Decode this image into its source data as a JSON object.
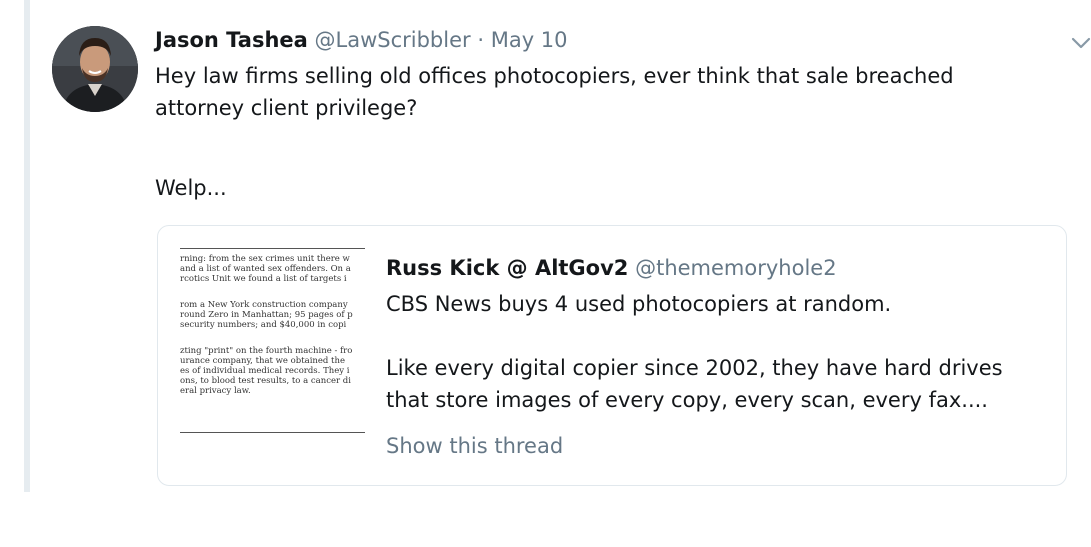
{
  "tweet": {
    "author_name": "Jason Tashea",
    "author_handle": "@LawScribbler",
    "separator": "·",
    "date": "May 10",
    "text_line1": "Hey law firms selling old offices photocopiers, ever think that sale breached attorney client privilege?",
    "text_line2": "Welp..."
  },
  "quoted": {
    "author_name": "Russ Kick @ AltGov2",
    "author_handle": "@thememoryhole2",
    "text_line1": "CBS News buys 4 used photocopiers at random.",
    "text_line2": "Like every digital copier since 2002, they have hard drives that store images of every copy, every scan, every fax....",
    "show_thread": "Show this thread",
    "thumbnail_paragraphs": [
      [
        "rning: from the sex crimes unit there w",
        "and a list of wanted sex offenders. On a",
        "rcotics Unit we found a list of targets i"
      ],
      [
        "rom a New York construction company",
        "round Zero in Manhattan; 95 pages of p",
        "security numbers; and $40,000 in copi"
      ],
      [
        "zting \"print\" on the fourth machine - fro",
        "urance company, that we obtained the",
        "es of individual medical records. They i",
        "ons, to blood test results, to a cancer di",
        "eral privacy law."
      ]
    ]
  },
  "icons": {
    "chevron": "chevron-down-icon",
    "avatar": "avatar"
  },
  "colors": {
    "text": "#14171a",
    "muted": "#657786",
    "border": "#e1e8ed",
    "thread_line": "#e6ecf0"
  }
}
